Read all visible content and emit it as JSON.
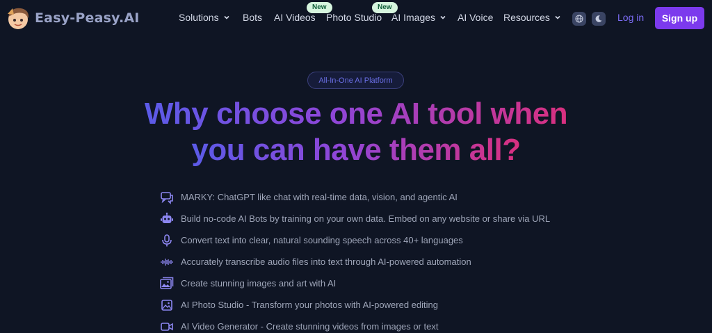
{
  "brand": {
    "name": "Easy-Peasy.AI"
  },
  "nav": {
    "items": [
      {
        "label": "Solutions",
        "dropdown": true
      },
      {
        "label": "Bots"
      },
      {
        "label": "AI Videos",
        "badge": "New"
      },
      {
        "label": "Photo Studio",
        "badge": "New"
      },
      {
        "label": "AI Images",
        "dropdown": true
      },
      {
        "label": "AI Voice"
      },
      {
        "label": "Resources",
        "dropdown": true
      }
    ],
    "login": "Log in",
    "signup": "Sign up"
  },
  "hero": {
    "pill": "All-In-One AI Platform",
    "headline_line1": "Why choose one AI tool when",
    "headline_line2": "you can have them all?"
  },
  "features": [
    {
      "icon": "chat-icon",
      "text": "MARKY: ChatGPT like chat with real-time data, vision, and agentic AI"
    },
    {
      "icon": "robot-icon",
      "text": "Build no-code AI Bots by training on your own data. Embed on any website or share via URL"
    },
    {
      "icon": "microphone-icon",
      "text": "Convert text into clear, natural sounding speech across 40+ languages"
    },
    {
      "icon": "waveform-icon",
      "text": "Accurately transcribe audio files into text through AI-powered automation"
    },
    {
      "icon": "images-icon",
      "text": "Create stunning images and art with AI"
    },
    {
      "icon": "photo-icon",
      "text": "AI Photo Studio - Transform your photos with AI-powered editing"
    },
    {
      "icon": "video-icon",
      "text": "AI Video Generator - Create stunning videos from images or text"
    }
  ],
  "colors": {
    "background": "#0f1524",
    "accent": "#7c3aed",
    "gradient_start": "#5b5be8",
    "gradient_end": "#d9307f",
    "icon": "#8c86f0"
  }
}
